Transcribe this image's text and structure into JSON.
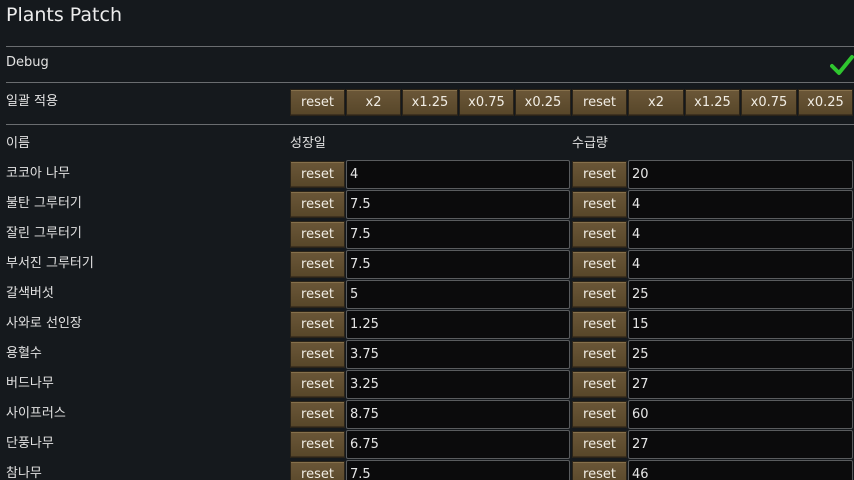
{
  "title": "Plants Patch",
  "debug": {
    "label": "Debug",
    "checked": true,
    "check_icon": "checkmark-icon",
    "check_color": "#2fc62f"
  },
  "bulk": {
    "label": "일괄 적용",
    "growth_buttons": [
      "reset",
      "x2",
      "x1.25",
      "x0.75",
      "x0.25"
    ],
    "harvest_buttons": [
      "reset",
      "x2",
      "x1.25",
      "x0.75",
      "x0.25"
    ]
  },
  "columns": {
    "name": "이름",
    "growth": "성장일",
    "harvest": "수급량"
  },
  "reset_label": "reset",
  "rows": [
    {
      "name": "코코아 나무",
      "growth": "4",
      "harvest": "20"
    },
    {
      "name": "불탄 그루터기",
      "growth": "7.5",
      "harvest": "4"
    },
    {
      "name": "잘린 그루터기",
      "growth": "7.5",
      "harvest": "4"
    },
    {
      "name": "부서진 그루터기",
      "growth": "7.5",
      "harvest": "4"
    },
    {
      "name": "갈색버섯",
      "growth": "5",
      "harvest": "25"
    },
    {
      "name": "사와로 선인장",
      "growth": "1.25",
      "harvest": "15"
    },
    {
      "name": "용혈수",
      "growth": "3.75",
      "harvest": "25"
    },
    {
      "name": "버드나무",
      "growth": "3.25",
      "harvest": "27"
    },
    {
      "name": "사이프러스",
      "growth": "8.75",
      "harvest": "60"
    },
    {
      "name": "단풍나무",
      "growth": "6.75",
      "harvest": "27"
    },
    {
      "name": "참나무",
      "growth": "7.5",
      "harvest": "46"
    }
  ]
}
